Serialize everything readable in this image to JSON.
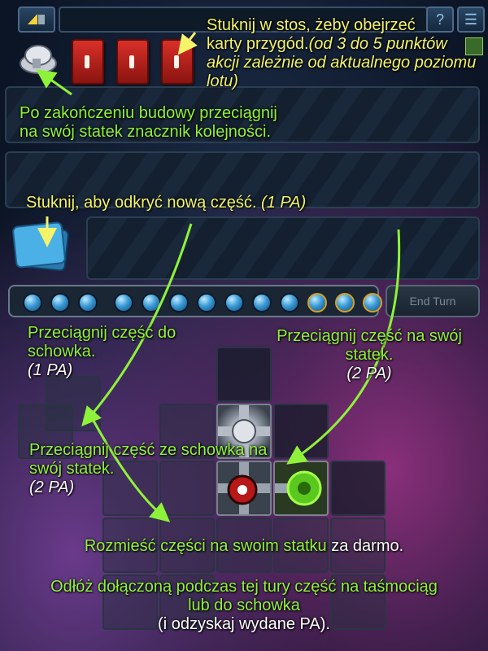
{
  "top": {
    "menu_label": "☰",
    "help_label": "?"
  },
  "tips": {
    "stack_line1": "Stuknij w stos, żeby obejrzeć",
    "stack_line2": "karty przygód.",
    "stack_italic": "(od 3 do 5 punktów akcji zależnie od aktualnego poziomu lotu)",
    "marker": "Po zakończeniu budowy przeciągnij na swój statek znacznik kolejności.",
    "reveal_text": "Stuknij, aby odkryć nową część.",
    "reveal_cost": "(1 PA)",
    "to_storage": "Przeciągnij część do schowka.",
    "to_storage_cost": "(1 PA)",
    "to_ship": "Przeciągnij część na swój statek.",
    "to_ship_cost": "(2 PA)",
    "from_storage": "Przeciągnij część ze schowka na swój statek.",
    "from_storage_cost": "(2 PA)",
    "arrange_a": "Rozmieść części na swoim statku",
    "arrange_b": "za darmo.",
    "return_a": "Odłóż dołączoną podczas tej tury część na taśmociąg lub do schowka",
    "return_b": "(i odzyskaj wydane PA)."
  },
  "track": {
    "dots": 13,
    "gold_from": 10
  },
  "end_turn_label": "End Turn",
  "colors": {
    "tip_green": "#8ff23a",
    "tip_yellow": "#f4f46a",
    "arrow": "#8ff23a"
  }
}
